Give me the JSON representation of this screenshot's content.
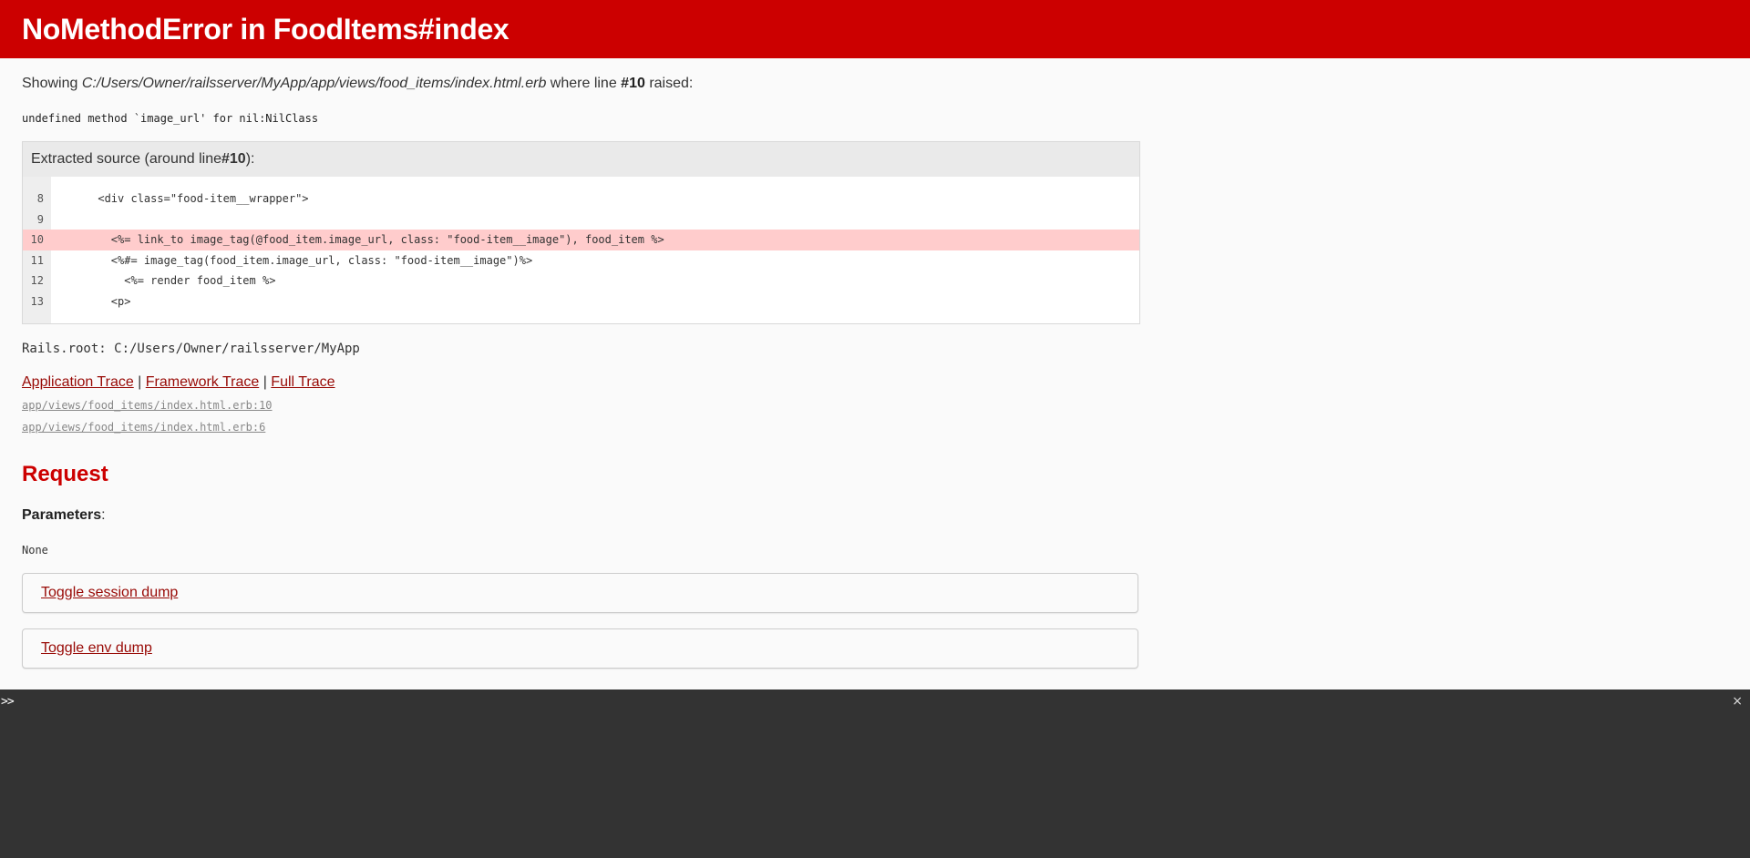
{
  "header": {
    "title": "NoMethodError in FoodItems#index"
  },
  "showing": {
    "prefix": "Showing ",
    "path": "C:/Users/Owner/railsserver/MyApp/app/views/food_items/index.html.erb",
    "middle": " where line ",
    "line": "#10",
    "suffix": " raised:"
  },
  "error_message": "undefined method `image_url' for nil:NilClass",
  "source": {
    "header_prefix": "Extracted source (around line ",
    "header_line": "#10",
    "header_suffix": "):",
    "lines": [
      {
        "num": "8",
        "code": "      <div class=\"food-item__wrapper\">",
        "highlight": false
      },
      {
        "num": "9",
        "code": "",
        "highlight": false
      },
      {
        "num": "10",
        "code": "        <%= link_to image_tag(@food_item.image_url, class: \"food-item__image\"), food_item %>",
        "highlight": true
      },
      {
        "num": "11",
        "code": "        <%#= image_tag(food_item.image_url, class: \"food-item__image\")%>",
        "highlight": false
      },
      {
        "num": "12",
        "code": "          <%= render food_item %>",
        "highlight": false
      },
      {
        "num": "13",
        "code": "        <p>",
        "highlight": false
      }
    ]
  },
  "rails_root": "Rails.root: C:/Users/Owner/railsserver/MyApp",
  "traces": {
    "application": "Application Trace",
    "framework": "Framework Trace",
    "full": "Full Trace",
    "separator": " | ",
    "lines": [
      "app/views/food_items/index.html.erb:10",
      "app/views/food_items/index.html.erb:6"
    ]
  },
  "request": {
    "title": "Request",
    "params_label": "Parameters",
    "params_colon": ":",
    "params_value": "None"
  },
  "toggles": {
    "session": "Toggle session dump",
    "env": "Toggle env dump"
  },
  "console": {
    "prompt": ">>",
    "close": "×"
  },
  "colors": {
    "header_bg": "#cc0000",
    "link": "#980905",
    "highlight": "#ffcccc",
    "console_bg": "#333333"
  }
}
